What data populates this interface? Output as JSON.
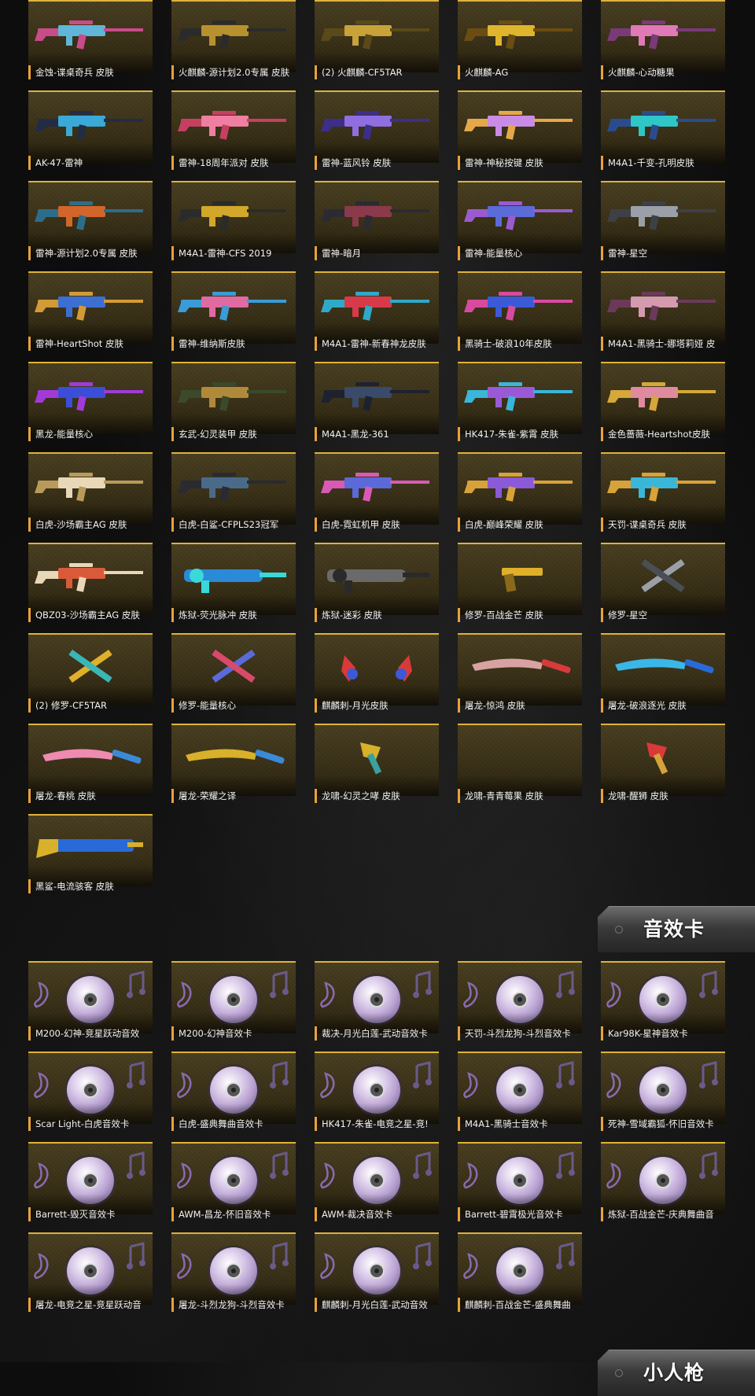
{
  "weapon_skins": [
    {
      "label": "金蚀-谍桌奇兵 皮肤",
      "kind": "rifle",
      "colors": [
        "#5fb6d8",
        "#c94b8a"
      ]
    },
    {
      "label": "火麒麟-源计划2.0专属 皮肤",
      "kind": "rifle",
      "colors": [
        "#b8912f",
        "#2b2b2b"
      ]
    },
    {
      "label": "(2) 火麒麟-CF5TAR",
      "kind": "rifle",
      "colors": [
        "#c8a33a",
        "#5a4a1a"
      ]
    },
    {
      "label": "火麒麟-AG",
      "kind": "rifle",
      "colors": [
        "#e0b52e",
        "#6b4d12"
      ]
    },
    {
      "label": "火麒麟-心动糖果",
      "kind": "rifle",
      "colors": [
        "#e07ab6",
        "#7a3a78"
      ]
    },
    {
      "label": "AK-47-雷神",
      "kind": "rifle",
      "colors": [
        "#3aa9d6",
        "#222c44"
      ]
    },
    {
      "label": "雷神-18周年派对 皮肤",
      "kind": "rifle",
      "colors": [
        "#ef7fa0",
        "#c54060"
      ]
    },
    {
      "label": "雷神-蓝风铃 皮肤",
      "kind": "rifle",
      "colors": [
        "#8f6ee0",
        "#3d2e8a"
      ]
    },
    {
      "label": "雷神-神秘按键 皮肤",
      "kind": "rifle",
      "colors": [
        "#c98be6",
        "#e4a84a"
      ]
    },
    {
      "label": "M4A1-千变-孔明皮肤",
      "kind": "rifle",
      "colors": [
        "#2fc6c7",
        "#2a4c8f"
      ]
    },
    {
      "label": "雷神-源计划2.0专属 皮肤",
      "kind": "rifle",
      "colors": [
        "#d2662a",
        "#2d6d8a"
      ]
    },
    {
      "label": "M4A1-雷神-CFS 2019",
      "kind": "rifle",
      "colors": [
        "#d2a72a",
        "#2b2b2b"
      ]
    },
    {
      "label": "雷神-暗月",
      "kind": "rifle",
      "colors": [
        "#8a3a4a",
        "#2b2b33"
      ]
    },
    {
      "label": "雷神-能量核心",
      "kind": "rifle",
      "colors": [
        "#5b6bd8",
        "#9b5ad1"
      ]
    },
    {
      "label": "雷神-星空",
      "kind": "rifle",
      "colors": [
        "#9ba0a8",
        "#3d4046"
      ]
    },
    {
      "label": "雷神-HeartShot 皮肤",
      "kind": "rifle",
      "colors": [
        "#3c6fd2",
        "#d39a36"
      ]
    },
    {
      "label": "雷神-维纳斯皮肤",
      "kind": "rifle",
      "colors": [
        "#e06aa2",
        "#3a9bd6"
      ]
    },
    {
      "label": "M4A1-雷神-新春神龙皮肤",
      "kind": "rifle",
      "colors": [
        "#d83a4a",
        "#2fa9c8"
      ]
    },
    {
      "label": "黑骑士-破浪10年皮肤",
      "kind": "rifle",
      "colors": [
        "#3a5ad8",
        "#d84aa0"
      ]
    },
    {
      "label": "M4A1-黑骑士-娜塔莉娅 皮",
      "kind": "rifle",
      "colors": [
        "#d49ab0",
        "#6b3a5a"
      ]
    },
    {
      "label": "黑龙-能量核心",
      "kind": "rifle",
      "colors": [
        "#3a4ed8",
        "#a23ad8"
      ]
    },
    {
      "label": "玄武-幻灵装甲 皮肤",
      "kind": "rifle",
      "colors": [
        "#b08a3a",
        "#3a4a2a"
      ]
    },
    {
      "label": "M4A1-黑龙-361",
      "kind": "rifle",
      "colors": [
        "#3a4a6a",
        "#1e2230"
      ]
    },
    {
      "label": "HK417-朱雀-紫霄 皮肤",
      "kind": "rifle",
      "colors": [
        "#9a5ad8",
        "#3ab6d8"
      ]
    },
    {
      "label": "金色蔷薇-Heartshot皮肤",
      "kind": "rifle",
      "colors": [
        "#e08aa0",
        "#d4a83a"
      ]
    },
    {
      "label": "白虎-沙场霸主AG 皮肤",
      "kind": "rifle",
      "colors": [
        "#e8d8b8",
        "#b89a5a"
      ]
    },
    {
      "label": "白虎-白鲨-CFPLS23冠军",
      "kind": "rifle",
      "colors": [
        "#4a6a8a",
        "#2a2a33"
      ]
    },
    {
      "label": "白虎-霓虹机甲 皮肤",
      "kind": "rifle",
      "colors": [
        "#5a6ad8",
        "#d85ab6"
      ]
    },
    {
      "label": "白虎-巅峰荣耀 皮肤",
      "kind": "rifle",
      "colors": [
        "#8a5ad8",
        "#d8a23a"
      ]
    },
    {
      "label": "天罚-谍桌奇兵 皮肤",
      "kind": "rifle",
      "colors": [
        "#3ab6d8",
        "#d8a23a"
      ]
    },
    {
      "label": "QBZ03-沙场霸主AG 皮肤",
      "kind": "rifle",
      "colors": [
        "#d85a3a",
        "#e8d8b8"
      ]
    },
    {
      "label": "炼狱-荧光脉冲 皮肤",
      "kind": "chain",
      "colors": [
        "#2a8ad8",
        "#3ad8d8"
      ]
    },
    {
      "label": "炼狱-迷彩 皮肤",
      "kind": "chain",
      "colors": [
        "#6a6a6a",
        "#2a2a2a"
      ]
    },
    {
      "label": "修罗-百战金芒 皮肤",
      "kind": "pistol",
      "colors": [
        "#e0b02a",
        "#8a6a1a"
      ]
    },
    {
      "label": "修罗-星空",
      "kind": "dual",
      "colors": [
        "#9aa0a8",
        "#4a4e55"
      ]
    },
    {
      "label": "(2) 修罗-CF5TAR",
      "kind": "dual",
      "colors": [
        "#e0b02a",
        "#3ab6b6"
      ]
    },
    {
      "label": "修罗-能量核心",
      "kind": "dual",
      "colors": [
        "#5a6ad8",
        "#d84a6a"
      ]
    },
    {
      "label": "麒麟刺-月光皮肤",
      "kind": "claws",
      "colors": [
        "#d83a3a",
        "#3a5ad8"
      ]
    },
    {
      "label": "屠龙-惊鸿 皮肤",
      "kind": "blade",
      "colors": [
        "#d8a2a2",
        "#d83a3a"
      ]
    },
    {
      "label": "屠龙-破浪逐光 皮肤",
      "kind": "blade",
      "colors": [
        "#3ab6e8",
        "#2a6ad8"
      ]
    },
    {
      "label": "屠龙-春桃 皮肤",
      "kind": "blade",
      "colors": [
        "#ef8ab0",
        "#3a8ad8"
      ]
    },
    {
      "label": "屠龙-荣耀之译",
      "kind": "blade",
      "colors": [
        "#d8b02a",
        "#3a8ad8"
      ]
    },
    {
      "label": "龙啸-幻灵之哮 皮肤",
      "kind": "axe",
      "colors": [
        "#d8b02a",
        "#3aa0a0"
      ]
    },
    {
      "label": "龙啸-青青莓果 皮肤",
      "kind": "none",
      "colors": [
        "#000000",
        "#000000"
      ]
    },
    {
      "label": "龙啸-醒狮 皮肤",
      "kind": "axe",
      "colors": [
        "#d83a3a",
        "#d8a23a"
      ]
    },
    {
      "label": "黑鲨-电流骇客 皮肤",
      "kind": "heavy",
      "colors": [
        "#2a6ad8",
        "#d8b02a"
      ]
    }
  ],
  "sound_section": {
    "title": "音效卡"
  },
  "sound_cards": [
    {
      "label": "M200-幻神-竞星跃动音效"
    },
    {
      "label": "M200-幻神音效卡"
    },
    {
      "label": "裁决-月光白莲-武动音效卡"
    },
    {
      "label": "天罚-斗烈龙狗-斗烈音效卡"
    },
    {
      "label": "Kar98K-星神音效卡"
    },
    {
      "label": "Scar Light-白虎音效卡"
    },
    {
      "label": "白虎-盛典舞曲音效卡"
    },
    {
      "label": "HK417-朱雀-电竞之星-竞!"
    },
    {
      "label": "M4A1-黑骑士音效卡"
    },
    {
      "label": "死神-雪域霸狐-怀旧音效卡"
    },
    {
      "label": "Barrett-毁灭音效卡"
    },
    {
      "label": "AWM-昌龙-怀旧音效卡"
    },
    {
      "label": "AWM-裁决音效卡"
    },
    {
      "label": "Barrett-碧霄极光音效卡"
    },
    {
      "label": "炼狱-百战金芒-庆典舞曲音"
    },
    {
      "label": "屠龙-电竞之星-竞星跃动音"
    },
    {
      "label": "屠龙-斗烈龙狗-斗烈音效卡"
    },
    {
      "label": "麒麟刺-月光白莲-武动音效"
    },
    {
      "label": "麒麟刺-百战金芒-盛典舞曲"
    }
  ],
  "next_section": {
    "title": "小人枪"
  },
  "colors": {
    "accent": "#e0b23a",
    "caption_bar": "#e8a23a",
    "card_bg": "#3b3219"
  }
}
